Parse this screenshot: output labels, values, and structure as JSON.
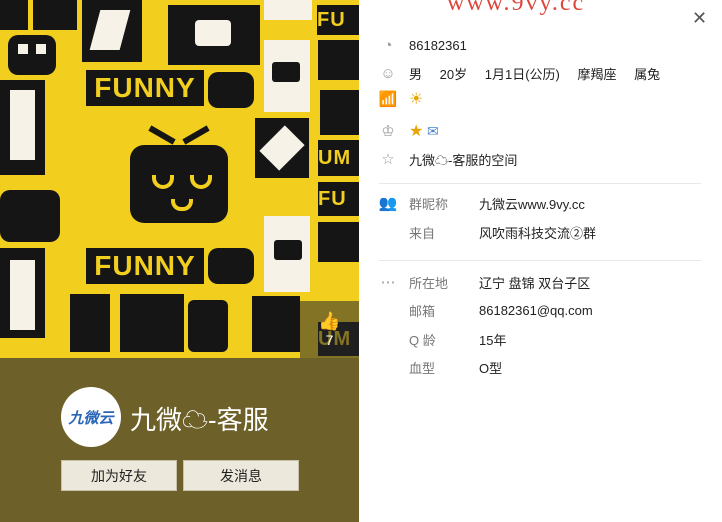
{
  "watermark_url": "www.9vy.cc",
  "profile": {
    "nickname": "九微☁-客服",
    "avatar_text": "九微云",
    "likes": "7",
    "cover_words": [
      "FUNNY",
      "FUNNY",
      "FU",
      "UM",
      "FU",
      "UM"
    ],
    "buttons": {
      "add_friend": "加为好友",
      "message": "发消息"
    }
  },
  "info": {
    "qq": "86182361",
    "gender": "男",
    "age": "20岁",
    "birthday": "1月1日(公历)",
    "constellation": "摩羯座",
    "zodiac": "属兔",
    "space": "九微☁-客服的空间"
  },
  "group": {
    "nick_label": "群昵称",
    "nick_value": "九微云www.9vy.cc",
    "from_label": "来自",
    "from_value": "风吹雨科技交流②群"
  },
  "details": {
    "location_label": "所在地",
    "location_value": "辽宁 盘锦 双台子区",
    "email_label": "邮箱",
    "email_value": "86182361@qq.com",
    "qage_label": "Q 龄",
    "qage_value": "15年",
    "blood_label": "血型",
    "blood_value": "O型"
  }
}
